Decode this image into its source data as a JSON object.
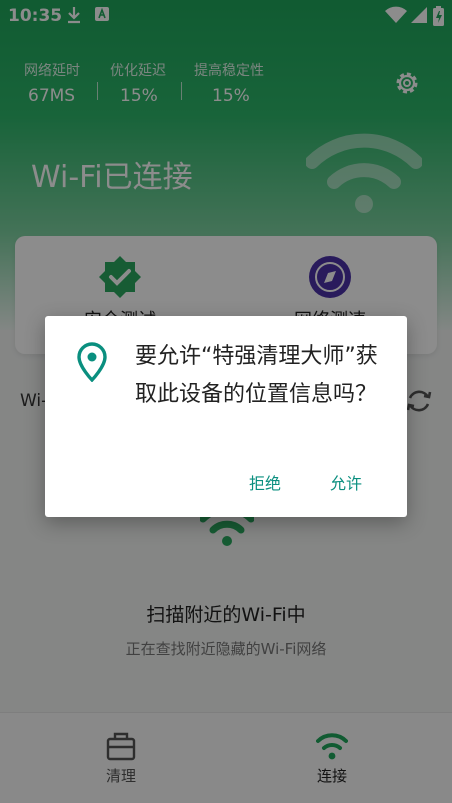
{
  "status_bar": {
    "time": "10:35"
  },
  "stats": [
    {
      "label": "网络延时",
      "value": "67MS"
    },
    {
      "label": "优化延迟",
      "value": "15%"
    },
    {
      "label": "提高稳定性",
      "value": "15%"
    }
  ],
  "header": {
    "title": "Wi-Fi已连接"
  },
  "cards": [
    {
      "label": "安全测试"
    },
    {
      "label": "网络测速"
    }
  ],
  "wifi_section": {
    "label": "Wi-"
  },
  "scan": {
    "title": "扫描附近的Wi-Fi中",
    "subtitle": "正在查找附近隐藏的Wi-Fi网络"
  },
  "bottom_nav": [
    {
      "label": "清理",
      "active": false
    },
    {
      "label": "连接",
      "active": true
    }
  ],
  "dialog": {
    "message": "要允许“特强清理大师”获取此设备的位置信息吗？",
    "deny": "拒绝",
    "allow": "允许"
  },
  "colors": {
    "primary": "#1fa65b",
    "dialog_accent": "#0a8f7f"
  }
}
